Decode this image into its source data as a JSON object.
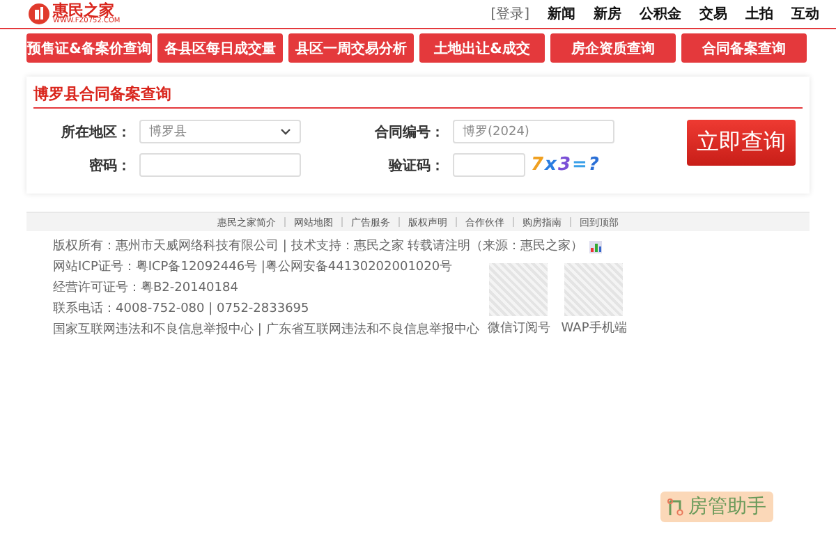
{
  "header": {
    "logo_title": "惠民之家",
    "logo_url": "WWW.FZ0752.COM",
    "login": "[登录]",
    "nav": [
      "新闻",
      "新房",
      "公积金",
      "交易",
      "土拍",
      "互动"
    ]
  },
  "quick_links": [
    "预售证&备案价查询",
    "各县区每日成交量",
    "县区一周交易分析",
    "土地出让&成交",
    "房企资质查询",
    "合同备案查询"
  ],
  "panel": {
    "title": "博罗县合同备案查询",
    "fields": [
      {
        "kind": "select",
        "label": "所在地区：",
        "value": "博罗县"
      },
      {
        "kind": "input",
        "label": "合同编号：",
        "value": "博罗(2024)"
      },
      {
        "kind": "input",
        "label": "密码："
      },
      {
        "kind": "captcha",
        "label": "验证码：",
        "captcha": "7x3=?"
      }
    ],
    "submit": "立即查询"
  },
  "footer": {
    "links": [
      "惠民之家简介",
      "网站地图",
      "广告服务",
      "版权声明",
      "合作伙伴",
      "购房指南",
      "回到顶部"
    ],
    "copyright": "版权所有：惠州市天威网络科技有限公司 | 技术支持：惠民之家 转载请注明（来源：惠民之家）",
    "lines": [
      "网站ICP证号：粤ICP备12092446号 |粤公网安备44130202001020号",
      "经营许可证号：粤B2-20140184",
      "联系电话：4008-752-080 | 0752-2833695",
      "国家互联网违法和不良信息举报中心 | 广东省互联网违法和不良信息举报中心"
    ],
    "qr_codes": [
      "微信订阅号",
      "WAP手机端"
    ]
  },
  "assistant": "房管助手"
}
